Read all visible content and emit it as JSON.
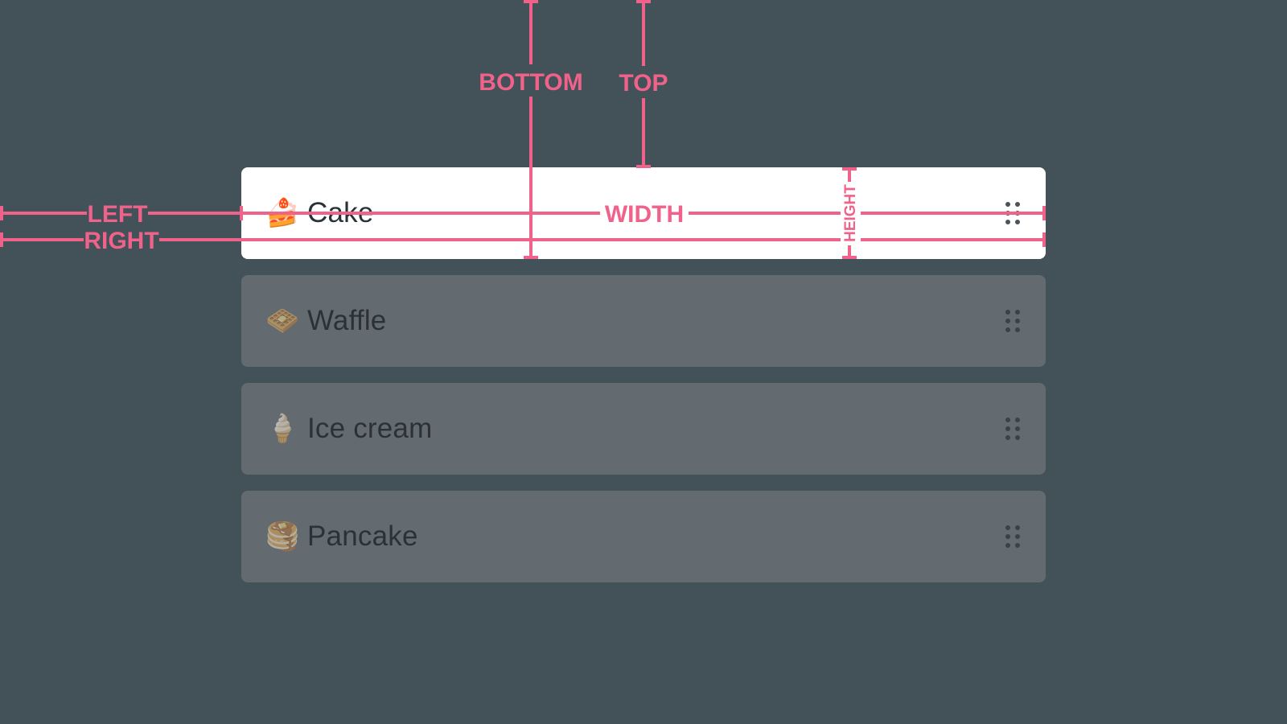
{
  "items": [
    {
      "emoji": "🍰",
      "label": "Cake"
    },
    {
      "emoji": "🧇",
      "label": "Waffle"
    },
    {
      "emoji": "🍦",
      "label": "Ice cream"
    },
    {
      "emoji": "🥞",
      "label": "Pancake"
    }
  ],
  "annotations": {
    "left": "LEFT",
    "right": "RIGHT",
    "top": "TOP",
    "bottom": "BOTTOM",
    "width": "WIDTH",
    "height": "HEIGHT"
  },
  "colors": {
    "background": "#435159",
    "active_item": "#ffffff",
    "inactive_item": "#636a70",
    "annotation": "#f0628a"
  },
  "icons": {
    "drag_handle": "drag-handle-icon"
  }
}
